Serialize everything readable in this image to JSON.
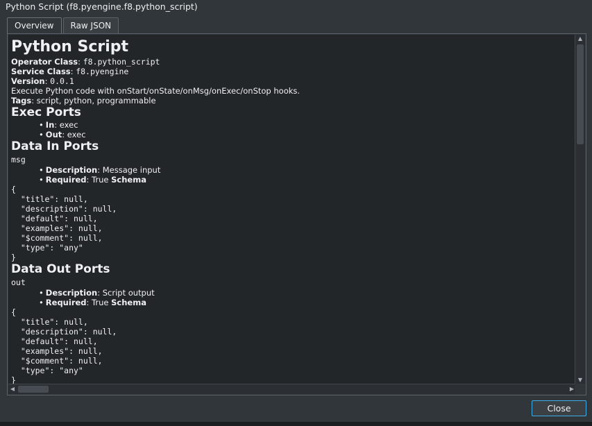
{
  "window": {
    "title": "Python Script  (f8.pyengine.f8.python_script)"
  },
  "tabs": [
    {
      "label": "Overview"
    },
    {
      "label": "Raw JSON"
    }
  ],
  "overview": {
    "title": "Python Script",
    "operator_class_label": "Operator Class",
    "operator_class": "f8.python_script",
    "service_class_label": "Service Class",
    "service_class": "f8.pyengine",
    "version_label": "Version",
    "version": "0.0.1",
    "description": "Execute Python code with onStart/onState/onMsg/onExec/onStop hooks.",
    "tags_label": "Tags",
    "tags": "script, python, programmable",
    "exec_ports_heading": "Exec Ports",
    "exec_ports": [
      {
        "name": "In",
        "value": "exec"
      },
      {
        "name": "Out",
        "value": "exec"
      }
    ],
    "data_in_heading": "Data In Ports",
    "data_in": {
      "port": "msg",
      "description_label": "Description",
      "description": "Message input",
      "required_label": "Required",
      "required": "True",
      "schema_label": "Schema",
      "schema": "{\n  \"title\": null,\n  \"description\": null,\n  \"default\": null,\n  \"examples\": null,\n  \"$comment\": null,\n  \"type\": \"any\"\n}"
    },
    "data_out_heading": "Data Out Ports",
    "data_out": {
      "port": "out",
      "description_label": "Description",
      "description": "Script output",
      "required_label": "Required",
      "required": "True",
      "schema_label": "Schema",
      "schema": "{\n  \"title\": null,\n  \"description\": null,\n  \"default\": null,\n  \"examples\": null,\n  \"$comment\": null,\n  \"type\": \"any\"\n}"
    }
  },
  "buttons": {
    "close": "Close"
  }
}
